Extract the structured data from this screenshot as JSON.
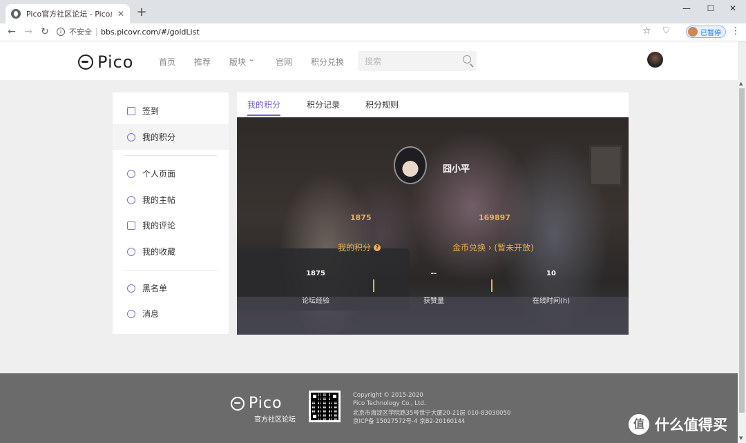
{
  "browser": {
    "tab_title": "Pico官方社区论坛 - Pico虚拟现实",
    "tab_close": "✕",
    "new_tab": "+",
    "window_controls": [
      "—",
      "☐",
      "✕"
    ],
    "nav": {
      "back": "←",
      "forward": "→",
      "reload": "↻"
    },
    "info_icon": "i",
    "insecure_label": "不安全",
    "url": "bbs.picovr.com/#/goldList",
    "bookmark_icon": "☆",
    "profile_label": "已暂停",
    "menu_icon": "⋮"
  },
  "site": {
    "logo_text": "Pico",
    "nav": {
      "home": "首页",
      "recommend": "推荐",
      "sections": "版块",
      "sections_caret": "⌄",
      "official": "官网",
      "redeem": "积分兑换"
    },
    "search_placeholder": "搜索"
  },
  "sidebar": {
    "checkin": "签到",
    "my_points": "我的积分",
    "profile": "个人页面",
    "my_posts": "我的主帖",
    "my_comments": "我的评论",
    "favorites": "我的收藏",
    "blacklist": "黑名单",
    "messages": "消息"
  },
  "tabs": {
    "my_points": "我的积分",
    "points_record": "积分记录",
    "points_rules": "积分规则"
  },
  "hero": {
    "username": "囧小平",
    "points_value": "1875",
    "coins_value": "169897",
    "points_label": "我的积分",
    "help_icon": "?",
    "coins_label": "金币兑换 › (暂未开放)",
    "stats": {
      "experience_value": "1875",
      "experience_label": "论坛经验",
      "likes_value": "--",
      "likes_label": "获赞量",
      "online_value": "10",
      "online_label": "在线时间(h)"
    }
  },
  "footer": {
    "logo_text": "Pico",
    "sub_label": "官方社区论坛",
    "copyright": "Copyright © 2015-2020",
    "company": "Pico Technology Co., Ltd.",
    "address": "北京市海淀区学院路35号世宁大厦20-21层 010-83030050",
    "icp": "京ICP备 15027572号-4 京B2-20160144"
  },
  "watermark": {
    "icon": "值",
    "text": "什么值得买"
  }
}
